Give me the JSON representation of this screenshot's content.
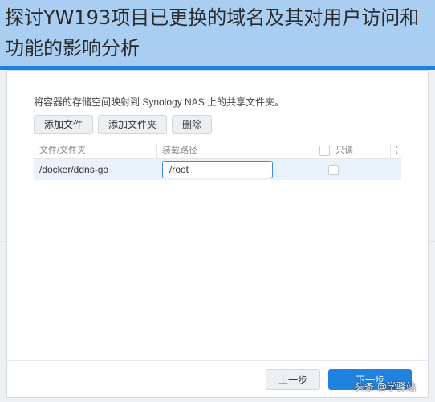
{
  "overlay": {
    "title": "探讨YW193项目已更换的域名及其对用户访问和功能的影响分析"
  },
  "dialog": {
    "intro": "将容器的存储空间映射到 Synology NAS 上的共享文件夹。",
    "toolbar": {
      "add_file": "添加文件",
      "add_folder": "添加文件夹",
      "delete": "删除"
    },
    "table": {
      "columns": {
        "file_folder": "文件/文件夹",
        "mount_path": "装载路径",
        "read_only": "只读"
      },
      "rows": [
        {
          "path": "/docker/ddns-go",
          "mount_value": "/root",
          "read_only": false
        }
      ]
    },
    "footer": {
      "prev": "上一步",
      "next": "下一步"
    }
  },
  "watermark": "头条 @学驿站",
  "colors": {
    "accent": "#1f82df",
    "banner": "#a8cdf1",
    "row_selected": "#e9f2fb"
  }
}
